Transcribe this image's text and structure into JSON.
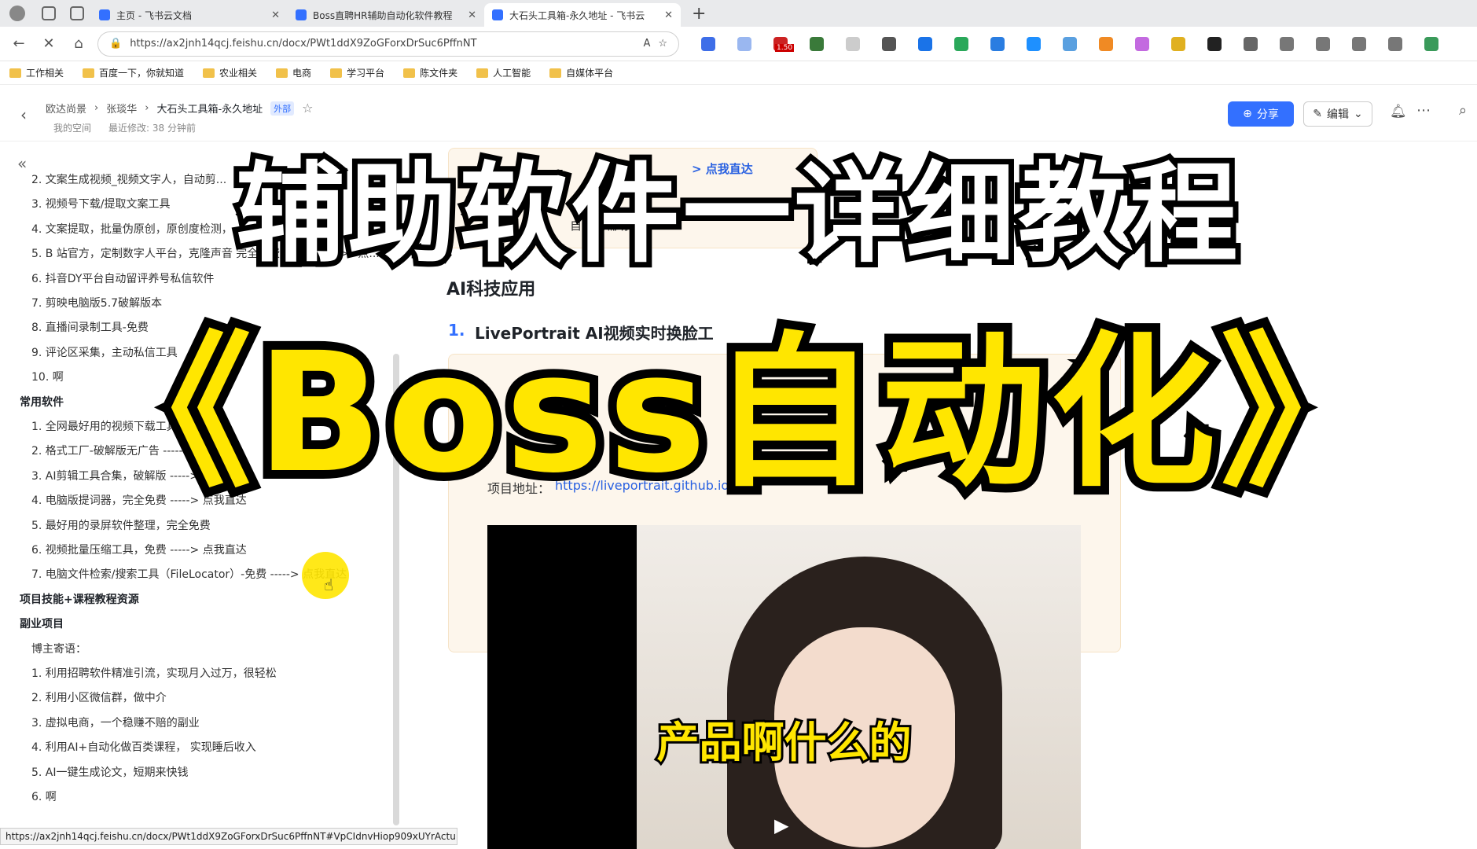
{
  "browser": {
    "tabs": [
      {
        "title": "主页 - 飞书云文档",
        "color": "#3370ff",
        "active": false
      },
      {
        "title": "Boss直聘HR辅助自动化软件教程",
        "color": "#3370ff",
        "active": false
      },
      {
        "title": "大石头工具箱-永久地址 - 飞书云",
        "color": "#3370ff",
        "active": true
      }
    ],
    "new_tab": "+",
    "url": "https://ax2jnh14qcj.feishu.cn/docx/PWt1ddX9ZoGForxDrSuc6PffnNT",
    "status_url": "https://ax2jnh14qcj.feishu.cn/docx/PWt1ddX9ZoGForxDrSuc6PffnNT#VpCIdnvHiop909xUYrActuKXnNc",
    "ext_badge": "1.50",
    "bookmarks": [
      "工作相关",
      "百度一下，你就知道",
      "农业相关",
      "电商",
      "学习平台",
      "陈文件夹",
      "人工智能",
      "自媒体平台"
    ]
  },
  "doc_header": {
    "breadcrumbs": [
      "欧达尚景",
      "张琰华",
      "大石头工具箱-永久地址"
    ],
    "external_tag": "外部",
    "space": "我的空间",
    "modified": "最近修改: 38 分钟前",
    "share_label": "分享",
    "edit_label": "编辑"
  },
  "sidebar": {
    "collapse": "«",
    "items": [
      {
        "text": "2. 文案生成视频_视频文字人，自动剪...",
        "heading": false
      },
      {
        "text": "3. 视频号下载/提取文案工具",
        "heading": false
      },
      {
        "text": "4. 文案提取，批量伪原创，原创度检测，",
        "heading": false
      },
      {
        "text": "5. B 站官方，定制数字人平台，克隆声音 完全免费，超级棒 --->>点...",
        "heading": false
      },
      {
        "text": "6. 抖音DY平台自动留评养号私信软件",
        "heading": false
      },
      {
        "text": "7. 剪映电脑版5.7破解版本",
        "heading": false
      },
      {
        "text": "8. 直播间录制工具-免费",
        "heading": false
      },
      {
        "text": "9. 评论区采集，主动私信工具",
        "heading": false
      },
      {
        "text": "10. 啊",
        "heading": false
      },
      {
        "text": "常用软件",
        "heading": true
      },
      {
        "text": "1. 全网最好用的视频下载工具-完全",
        "heading": false
      },
      {
        "text": "2. 格式工厂-破解版无广告 -----> 点我",
        "heading": false
      },
      {
        "text": "3. AI剪辑工具合集，破解版 -----> 点我",
        "heading": false
      },
      {
        "text": "4. 电脑版提词器，完全免费 -----> 点我直达",
        "heading": false
      },
      {
        "text": "5. 最好用的录屏软件整理，完全免费",
        "heading": false
      },
      {
        "text": "6. 视频批量压缩工具，免费 -----> 点我直达",
        "heading": false
      },
      {
        "text": "7. 电脑文件检索/搜索工具（FileLocator）-免费 -----> 点我直达",
        "heading": false
      },
      {
        "text": "项目技能+课程教程资源",
        "heading": true
      },
      {
        "text": "副业项目",
        "heading": true
      },
      {
        "text": "博主寄语：",
        "heading": false
      },
      {
        "text": "1. 利用招聘软件精准引流，实现月入过万，很轻松",
        "heading": false
      },
      {
        "text": "2. 利用小区微信群，做中介",
        "heading": false
      },
      {
        "text": "3. 虚拟电商，一个稳赚不赔的副业",
        "heading": false
      },
      {
        "text": "4. 利用AI+自动化做百类课程， 实现睡后收入",
        "heading": false
      },
      {
        "text": "5. AI一键生成论文，短期来快钱",
        "heading": false
      },
      {
        "text": "6. 啊",
        "heading": false
      }
    ]
  },
  "main": {
    "top_link": "> 点我直达",
    "callout_small": "自动化辅助软件",
    "section_title": "AI科技应用",
    "item_number": "1.",
    "item_title": "LivePortrait  AI视频实时换脸工",
    "project_label": "项目地址：",
    "project_url": "https://liveportrait.github.io/"
  },
  "overlay": {
    "line1": "辅助软件一详细教程",
    "line2": "《Boss自动化》",
    "subtitle": "产品啊什么的"
  }
}
